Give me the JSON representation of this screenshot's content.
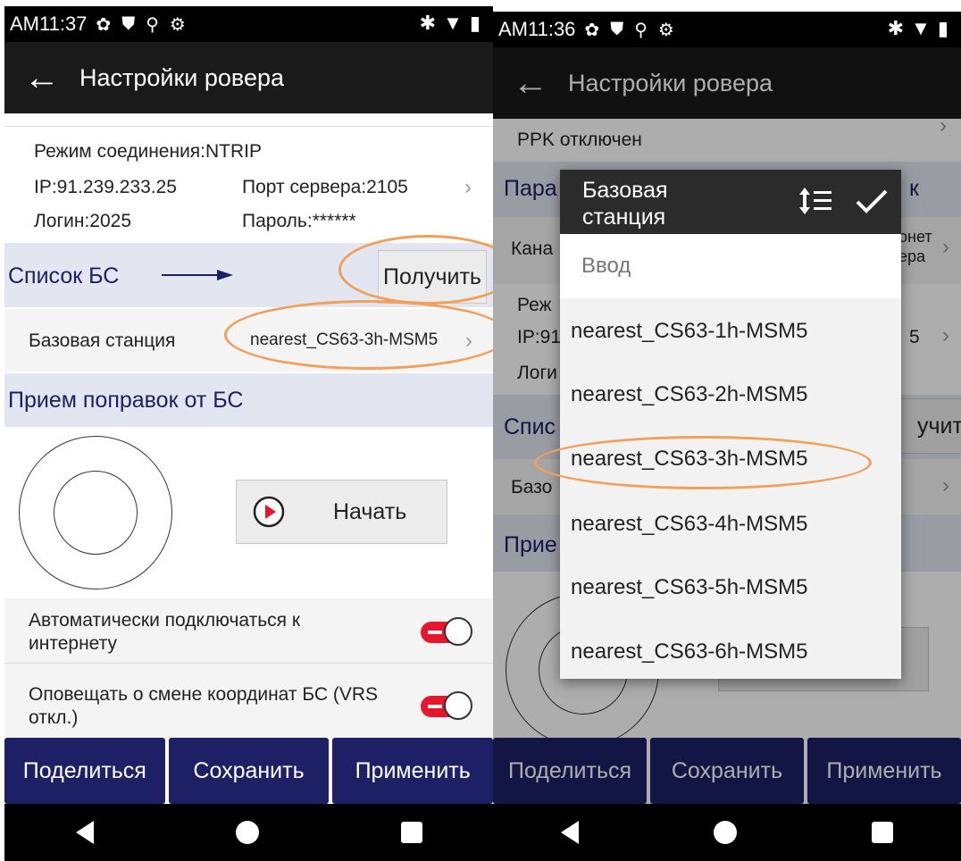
{
  "left": {
    "status": {
      "time": "AM11:37"
    },
    "title": "Настройки ровера",
    "connection": {
      "mode": "Режим соединения:NTRIP",
      "ip": "IP:91.239.233.25",
      "port": "Порт сервера:2105",
      "login": "Логин:2025",
      "password": "Пароль:******"
    },
    "bs_list": {
      "label": "Список БС",
      "get_button": "Получить"
    },
    "base_station": {
      "label": "Базовая станция",
      "value": "nearest_CS63-3h-MSM5"
    },
    "receive": {
      "header": "Прием поправок от БС",
      "start_button": "Начать"
    },
    "toggles": [
      {
        "label": "Автоматически подключаться к интернету",
        "on": true
      },
      {
        "label": "Оповещать о смене координат БС (VRS откл.)",
        "on": true
      }
    ]
  },
  "right": {
    "status": {
      "time": "AM11:36"
    },
    "title": "Настройки ровера",
    "ppk": "PPK отключен",
    "bg_fragments": {
      "params": "Пара",
      "params_end": "к",
      "channel": "Кана",
      "channel_r1": "онет",
      "channel_r2": "ера",
      "mode": "Реж",
      "ip": "IP:91",
      "port_end": "5",
      "login": "Логи",
      "list": "Спис",
      "get_end": "учить",
      "base": "Базо",
      "recv": "Прие"
    },
    "dialog": {
      "title": "Базовая станция",
      "input_placeholder": "Ввод",
      "items": [
        "nearest_CS63-1h-MSM5",
        "nearest_CS63-2h-MSM5",
        "nearest_CS63-3h-MSM5",
        "nearest_CS63-4h-MSM5",
        "nearest_CS63-5h-MSM5",
        "nearest_CS63-6h-MSM5"
      ],
      "selected_index": 2
    }
  },
  "bottom_buttons": [
    "Поделиться",
    "Сохранить",
    "Применить"
  ],
  "colors": {
    "bottom_bar": "#1d2065",
    "highlight_oval": "#f0a05a",
    "toggle_on": "#e8162d",
    "section_header": "#e3e6f0",
    "play_icon": "#e8162d"
  }
}
